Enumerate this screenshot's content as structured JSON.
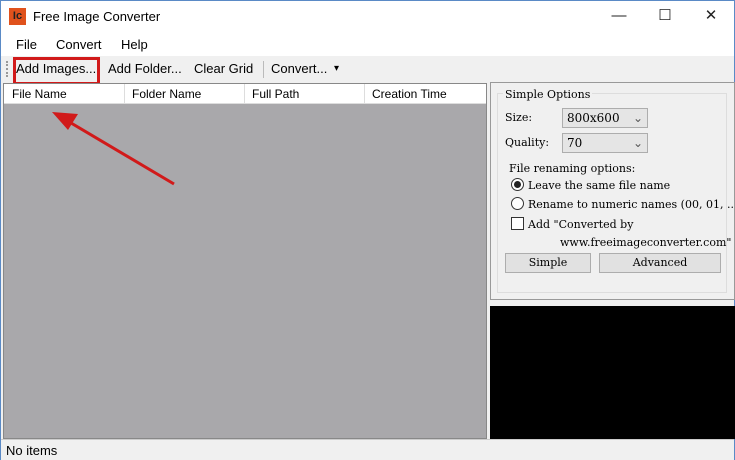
{
  "window": {
    "title": "Free Image Converter",
    "logo": "Ic",
    "minimize": "—",
    "maximize": "☐",
    "close": "✕"
  },
  "menu": [
    "File",
    "Convert",
    "Help"
  ],
  "toolbar": {
    "add_images": "Add Images...",
    "add_folder": "Add Folder...",
    "clear_grid": "Clear Grid",
    "convert": "Convert...",
    "dropdown": "▾"
  },
  "grid": {
    "columns": [
      "File Name",
      "Folder Name",
      "Full Path",
      "Creation Time"
    ]
  },
  "options": {
    "group_title": "Simple Options",
    "size_label": "Size:",
    "size_value": "800x600",
    "quality_label": "Quality:",
    "quality_value": "70",
    "renaming_label": "File renaming options:",
    "radio_leave": "Leave the same file name",
    "radio_rename": "Rename to numeric names (00, 01, ...",
    "checkbox_add": "Add \"Converted by",
    "checkbox_add_line2": "www.freeimageconverter.com\"",
    "simple_button": "Simple",
    "advanced_button": "Advanced",
    "selected_radio": "leave",
    "checkbox_checked": false
  },
  "status": {
    "text": "No items"
  },
  "highlight_color": "#d11a1a"
}
